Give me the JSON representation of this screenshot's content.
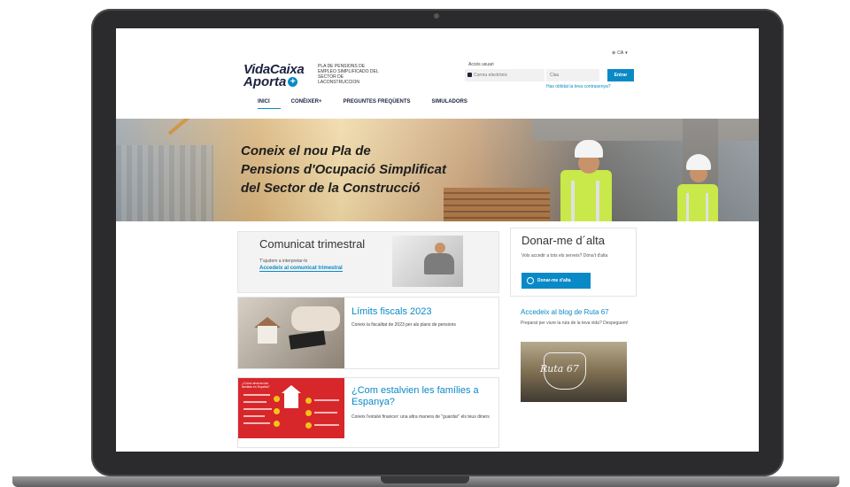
{
  "header": {
    "logo_line1": "VidaCaixa",
    "logo_line2": "Aporta",
    "logo_desc": "PLA DE PENSIONS DE EMPLEO SIMPLIFICADO DEL SECTOR DE LACONSTRUCCION",
    "language": "CA",
    "login_label": "Accés usuari",
    "email_placeholder": "Correu electrònic",
    "password_placeholder": "Clau",
    "enter_label": "Entrar",
    "forgot_label": "Has oblidat la teva contrasenya?"
  },
  "nav": {
    "items": [
      {
        "label": "INICI",
        "active": true
      },
      {
        "label": "CONÈIXER+",
        "active": false
      },
      {
        "label": "PREGUNTES FREQÜENTS",
        "active": false
      },
      {
        "label": "SIMULADORS",
        "active": false
      }
    ]
  },
  "hero": {
    "line1": "Coneix el nou Pla de",
    "line2": "Pensions d'Ocupació Simplificat",
    "line3": "del Sector de la Construcció"
  },
  "quarterly": {
    "title": "Comunicat trimestral",
    "subtitle": "T'ajudem a interpretar-lo",
    "link": "Accedeix al comunicat trimestral"
  },
  "limits": {
    "title": "Límits fiscals 2023",
    "subtitle": "Coneix la fiscalitat de 2023 per als plans de pensions"
  },
  "savings": {
    "title": "¿Com estalvien les famílies a Espanya?",
    "subtitle": "Coneix l'estalvi financer: una altra manera de \"guardar\" els teus diners",
    "image_text": "¿Cómo ahorran las familias en España?"
  },
  "signup": {
    "title": "Donar-me d´alta",
    "subtitle": "Vols accedir a tots els serveis? Dóna't d'alta",
    "button": "Donar-me d'alta"
  },
  "blog": {
    "title": "Accedeix al blog de Ruta 67",
    "subtitle": "Preparat per viure la ruta de la teva vida? Despeguem!",
    "image_logo": "Ruta 67"
  },
  "colors": {
    "accent": "#0a89c7",
    "brand_dark": "#1c2340"
  }
}
